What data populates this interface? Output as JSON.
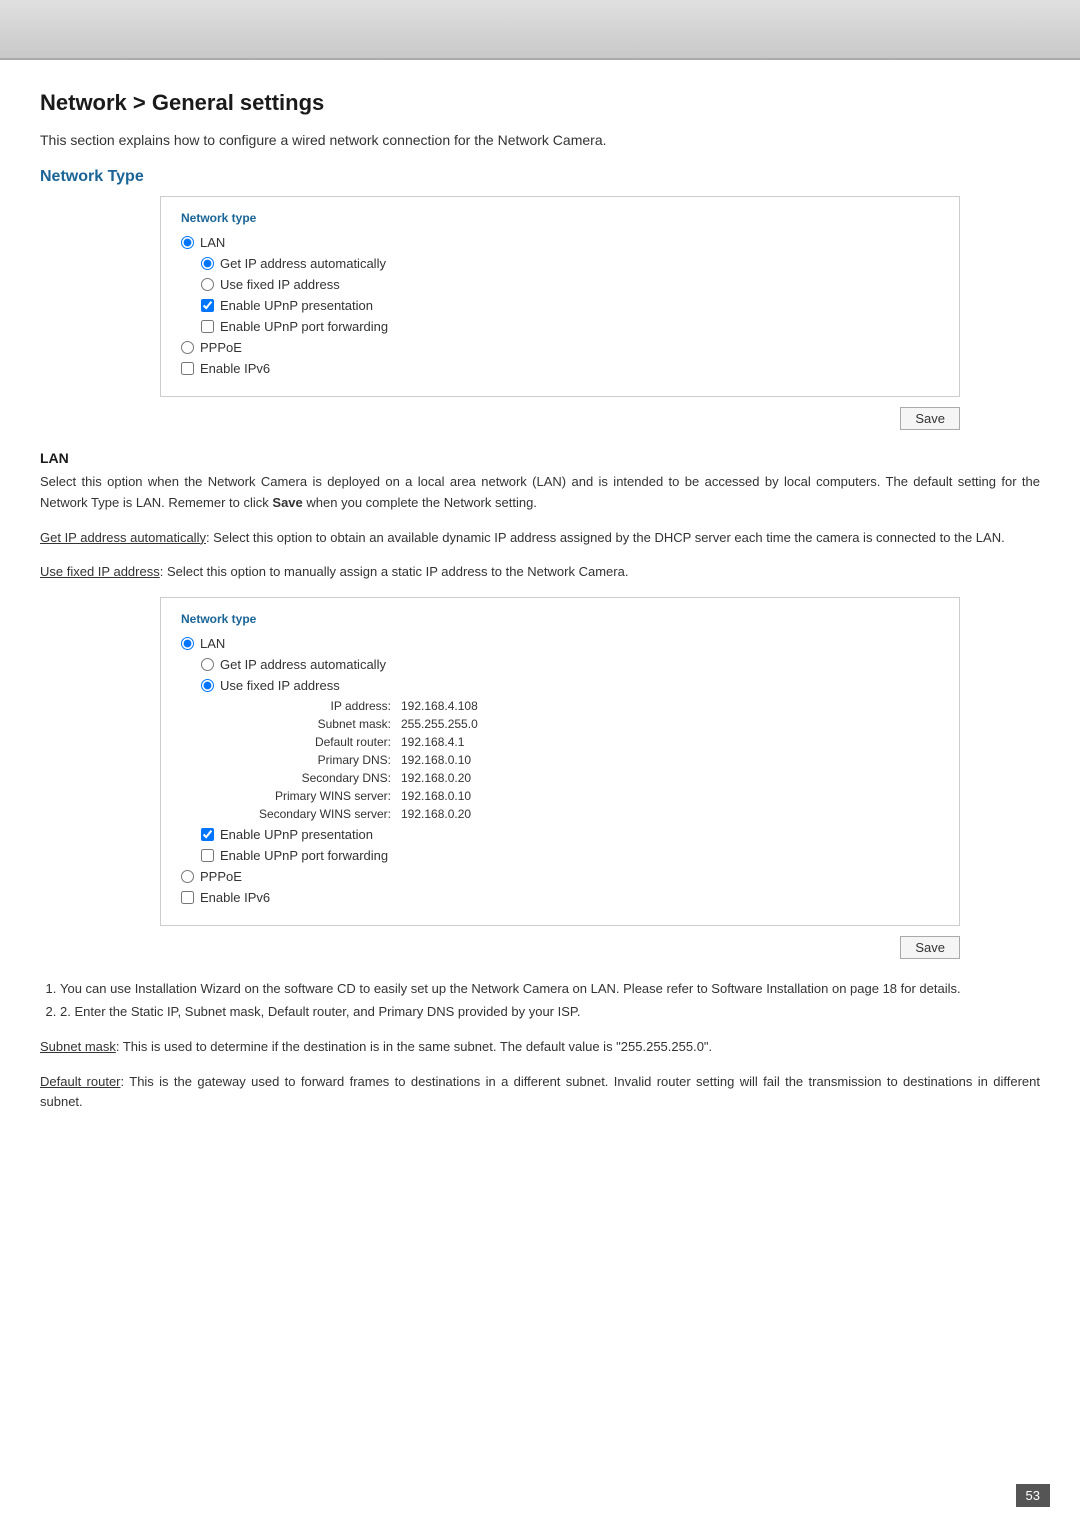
{
  "page": {
    "title": "Network > General settings",
    "intro": "This section explains how to configure a wired network connection for the Network Camera.",
    "network_type_heading": "Network Type",
    "box1_label": "Network type",
    "lan_radio": "LAN",
    "get_ip_auto": "Get IP address automatically",
    "use_fixed_ip": "Use fixed IP address",
    "enable_upnp_pres": "Enable UPnP presentation",
    "enable_upnp_port": "Enable UPnP port forwarding",
    "pppoe": "PPPoE",
    "enable_ipv6": "Enable IPv6",
    "save_label": "Save",
    "lan_heading": "LAN",
    "lan_desc1": "Select this option when the Network Camera is deployed on a local area network (LAN) and is intended to be accessed by local computers. The default setting for the Network Type is LAN. Rememer to click",
    "lan_desc1_bold": "Save",
    "lan_desc1_end": "when you complete the Network setting.",
    "get_ip_desc_link": "Get IP address automatically",
    "get_ip_desc": ": Select this option to obtain an available dynamic IP address assigned by the DHCP server each time the camera is connected to the LAN.",
    "use_fixed_desc_link": "Use fixed IP address",
    "use_fixed_desc": ": Select this option to manually assign a static IP address to the Network Camera.",
    "box2_label": "Network type",
    "lan_radio2": "LAN",
    "get_ip_auto2": "Get IP address automatically",
    "use_fixed_ip2": "Use fixed IP address",
    "ip_address_label": "IP address:",
    "ip_address_value": "192.168.4.108",
    "subnet_mask_label": "Subnet mask:",
    "subnet_mask_value": "255.255.255.0",
    "default_router_label": "Default router:",
    "default_router_value": "192.168.4.1",
    "primary_dns_label": "Primary DNS:",
    "primary_dns_value": "192.168.0.10",
    "secondary_dns_label": "Secondary DNS:",
    "secondary_dns_value": "192.168.0.20",
    "primary_wins_label": "Primary WINS server:",
    "primary_wins_value": "192.168.0.10",
    "secondary_wins_label": "Secondary WINS server:",
    "secondary_wins_value": "192.168.0.20",
    "enable_upnp_pres2": "Enable UPnP presentation",
    "enable_upnp_port2": "Enable UPnP port forwarding",
    "pppoe2": "PPPoE",
    "enable_ipv62": "Enable IPv6",
    "save_label2": "Save",
    "note1": "1. You can use Installation Wizard on the software CD to easily set up the Network Camera on LAN. Please refer to Software Installation on page 18 for details.",
    "note2": "2. Enter the Static IP, Subnet mask, Default router, and Primary DNS provided by your ISP.",
    "subnet_mask_heading": "Subnet mask",
    "subnet_mask_body": ": This is used to determine if the destination is in the same subnet. The default value is \"255.255.255.0\".",
    "default_router_heading": "Default router",
    "default_router_body": ": This is the gateway used to forward frames to destinations in a different subnet. Invalid router setting will fail the transmission to destinations in different subnet.",
    "page_number": "53"
  }
}
